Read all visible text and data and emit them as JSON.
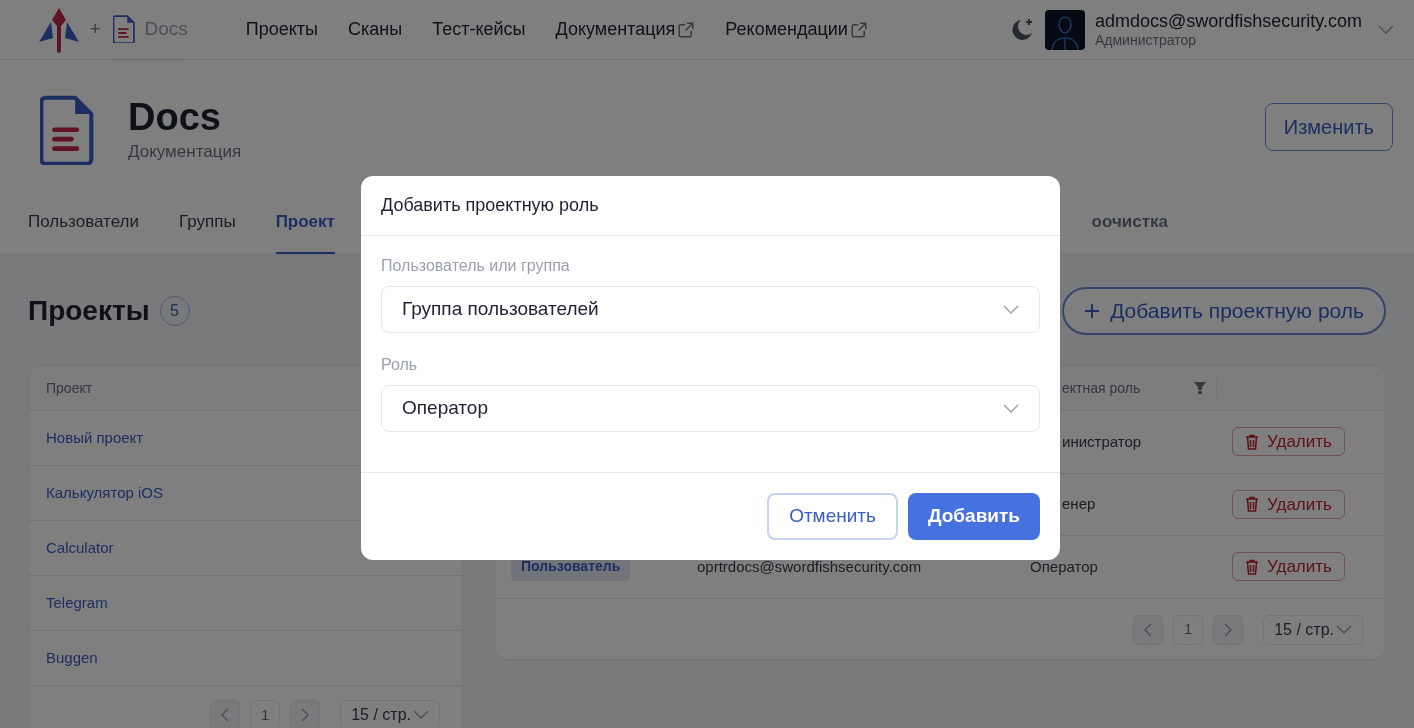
{
  "top_nav": {
    "separator": "+",
    "product": "Docs",
    "links": [
      {
        "label": "Проекты",
        "external": false
      },
      {
        "label": "Сканы",
        "external": false
      },
      {
        "label": "Тест-кейсы",
        "external": false
      },
      {
        "label": "Документация",
        "external": true
      },
      {
        "label": "Рекомендации",
        "external": true
      }
    ],
    "user": {
      "email": "admdocs@swordfishsecurity.com",
      "role": "Администратор"
    }
  },
  "project_header": {
    "title": "Docs",
    "subtitle": "Документация",
    "edit_button": "Изменить"
  },
  "tabs": [
    {
      "label": "Пользователи",
      "selected": false,
      "disabled": false
    },
    {
      "label": "Группы",
      "selected": false,
      "disabled": false
    },
    {
      "label": "Проект",
      "selected": true,
      "disabled": false
    },
    {
      "label": "оочистка",
      "selected": false,
      "disabled": true
    }
  ],
  "section": {
    "title": "Проекты",
    "count": "5",
    "add_button": "Добавить проектную роль"
  },
  "projects_table": {
    "columns": [
      "Проект"
    ],
    "rows": [
      "Новый проект",
      "Калькулятор iOS",
      "Calculator",
      "Telegram",
      "Buggen"
    ],
    "pagination": {
      "page": "1",
      "page_size": "15 / стр."
    }
  },
  "roles_table": {
    "columns": [
      {
        "label": "ектная роль",
        "filter": true
      }
    ],
    "rows": [
      {
        "role": "инистратор",
        "action": "Удалить"
      },
      {
        "role": "енер",
        "action": "Удалить"
      },
      {
        "type": "Пользователь",
        "email": "oprtrdocs@swordfishsecurity.com",
        "role": "Оператор",
        "action": "Удалить"
      }
    ],
    "pagination": {
      "page": "1",
      "page_size": "15 / стр."
    }
  },
  "dialog": {
    "title": "Добавить проектную роль",
    "fields": [
      {
        "label": "Пользователь или группа",
        "value": "Группа пользователей"
      },
      {
        "label": "Роль",
        "value": "Оператор"
      }
    ],
    "buttons": [
      {
        "label": "Отменить",
        "kind": "secondary"
      },
      {
        "label": "Добавить",
        "kind": "primary"
      }
    ]
  }
}
